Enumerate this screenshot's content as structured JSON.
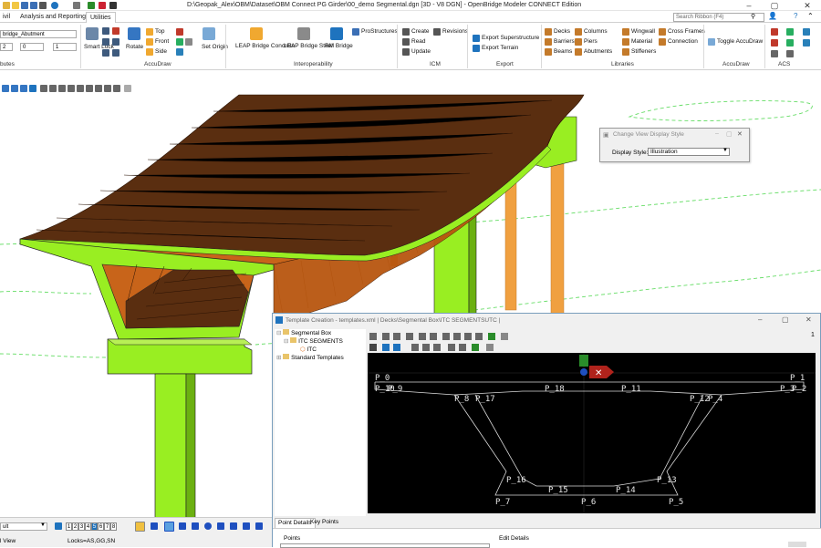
{
  "window": {
    "title": "D:\\Geopak_Alex\\OBM\\Dataset\\OBM Connect PG Girder\\00_demo Segmental.dgn [3D - V8 DGN] - OpenBridge Modeler CONNECT Edition",
    "search_placeholder": "Search Ribbon (F4)"
  },
  "tabs": [
    "ivil",
    "Analysis and Reporting",
    "Utilities"
  ],
  "ribbon": {
    "left": {
      "combo1": "bridge_Abutment",
      "val1": "2",
      "val2": "0",
      "val3": "1",
      "group": "butes"
    },
    "accudraw": {
      "smart_lock": "Smart Lock",
      "rotate": "Rotate",
      "top": "Top",
      "front": "Front",
      "side": "Side",
      "set_origin": "Set Origin",
      "group": "AccuDraw"
    },
    "interop": {
      "leap_concrete": "LEAP Bridge Concrete",
      "leap_steel": "LEAP Bridge Steel",
      "rm_bridge": "RM Bridge",
      "prostructures": "ProStructures",
      "group": "Interoperability"
    },
    "icm": {
      "create": "Create",
      "read": "Read",
      "update": "Update",
      "revisions": "Revisions",
      "group": "ICM"
    },
    "export": {
      "superstructure": "Export Superstructure",
      "terrain": "Export Terrain",
      "group": "Export"
    },
    "libraries": {
      "decks": "Decks",
      "barriers": "Barriers",
      "beams": "Beams",
      "columns": "Columns",
      "piers": "Piers",
      "abutments": "Abutments",
      "wingwall": "Wingwall",
      "material": "Material",
      "stiffeners": "Stiffeners",
      "cross_frames": "Cross Frames",
      "connection": "Connection",
      "group": "Libraries"
    },
    "accudraw2": {
      "toggle": "Toggle AccuDraw",
      "group": "AccuDraw"
    },
    "acs": {
      "group": "ACS"
    }
  },
  "change_view_dialog": {
    "title": "Change View Display Style",
    "label": "Display Style:",
    "value": "Illustration"
  },
  "template_window": {
    "title": "Template Creation - templates.xml  |  Decks\\Segmental Box\\ITC SEGMENTSUTC  |",
    "tree": [
      "Segmental Box",
      "ITC SEGMENTS",
      "ITC",
      "Standard Templates"
    ],
    "page_num": "1",
    "tabs": [
      "Point Details",
      "Key Points"
    ],
    "points_label": "Points",
    "edit_details_label": "Edit Details",
    "point_labels": [
      "P_0",
      "P_1",
      "P_10",
      "P_9",
      "P_8",
      "P_17",
      "P_18",
      "P_11",
      "P_12",
      "P_4",
      "P_3",
      "P_2",
      "P_16",
      "P_13",
      "P_15",
      "P_14",
      "P_7",
      "P_6",
      "P_5"
    ]
  },
  "status": {
    "level": "ult",
    "locks": "Locks=AS,GG,SN",
    "view": "l View",
    "view_numbers": [
      "1",
      "2",
      "3",
      "4",
      "5",
      "6",
      "7",
      "8"
    ]
  },
  "colors": {
    "deck_top": "#5a2e10",
    "deck_side": "#b8560f",
    "green": "#99ee22",
    "accent": "#1e73be"
  }
}
